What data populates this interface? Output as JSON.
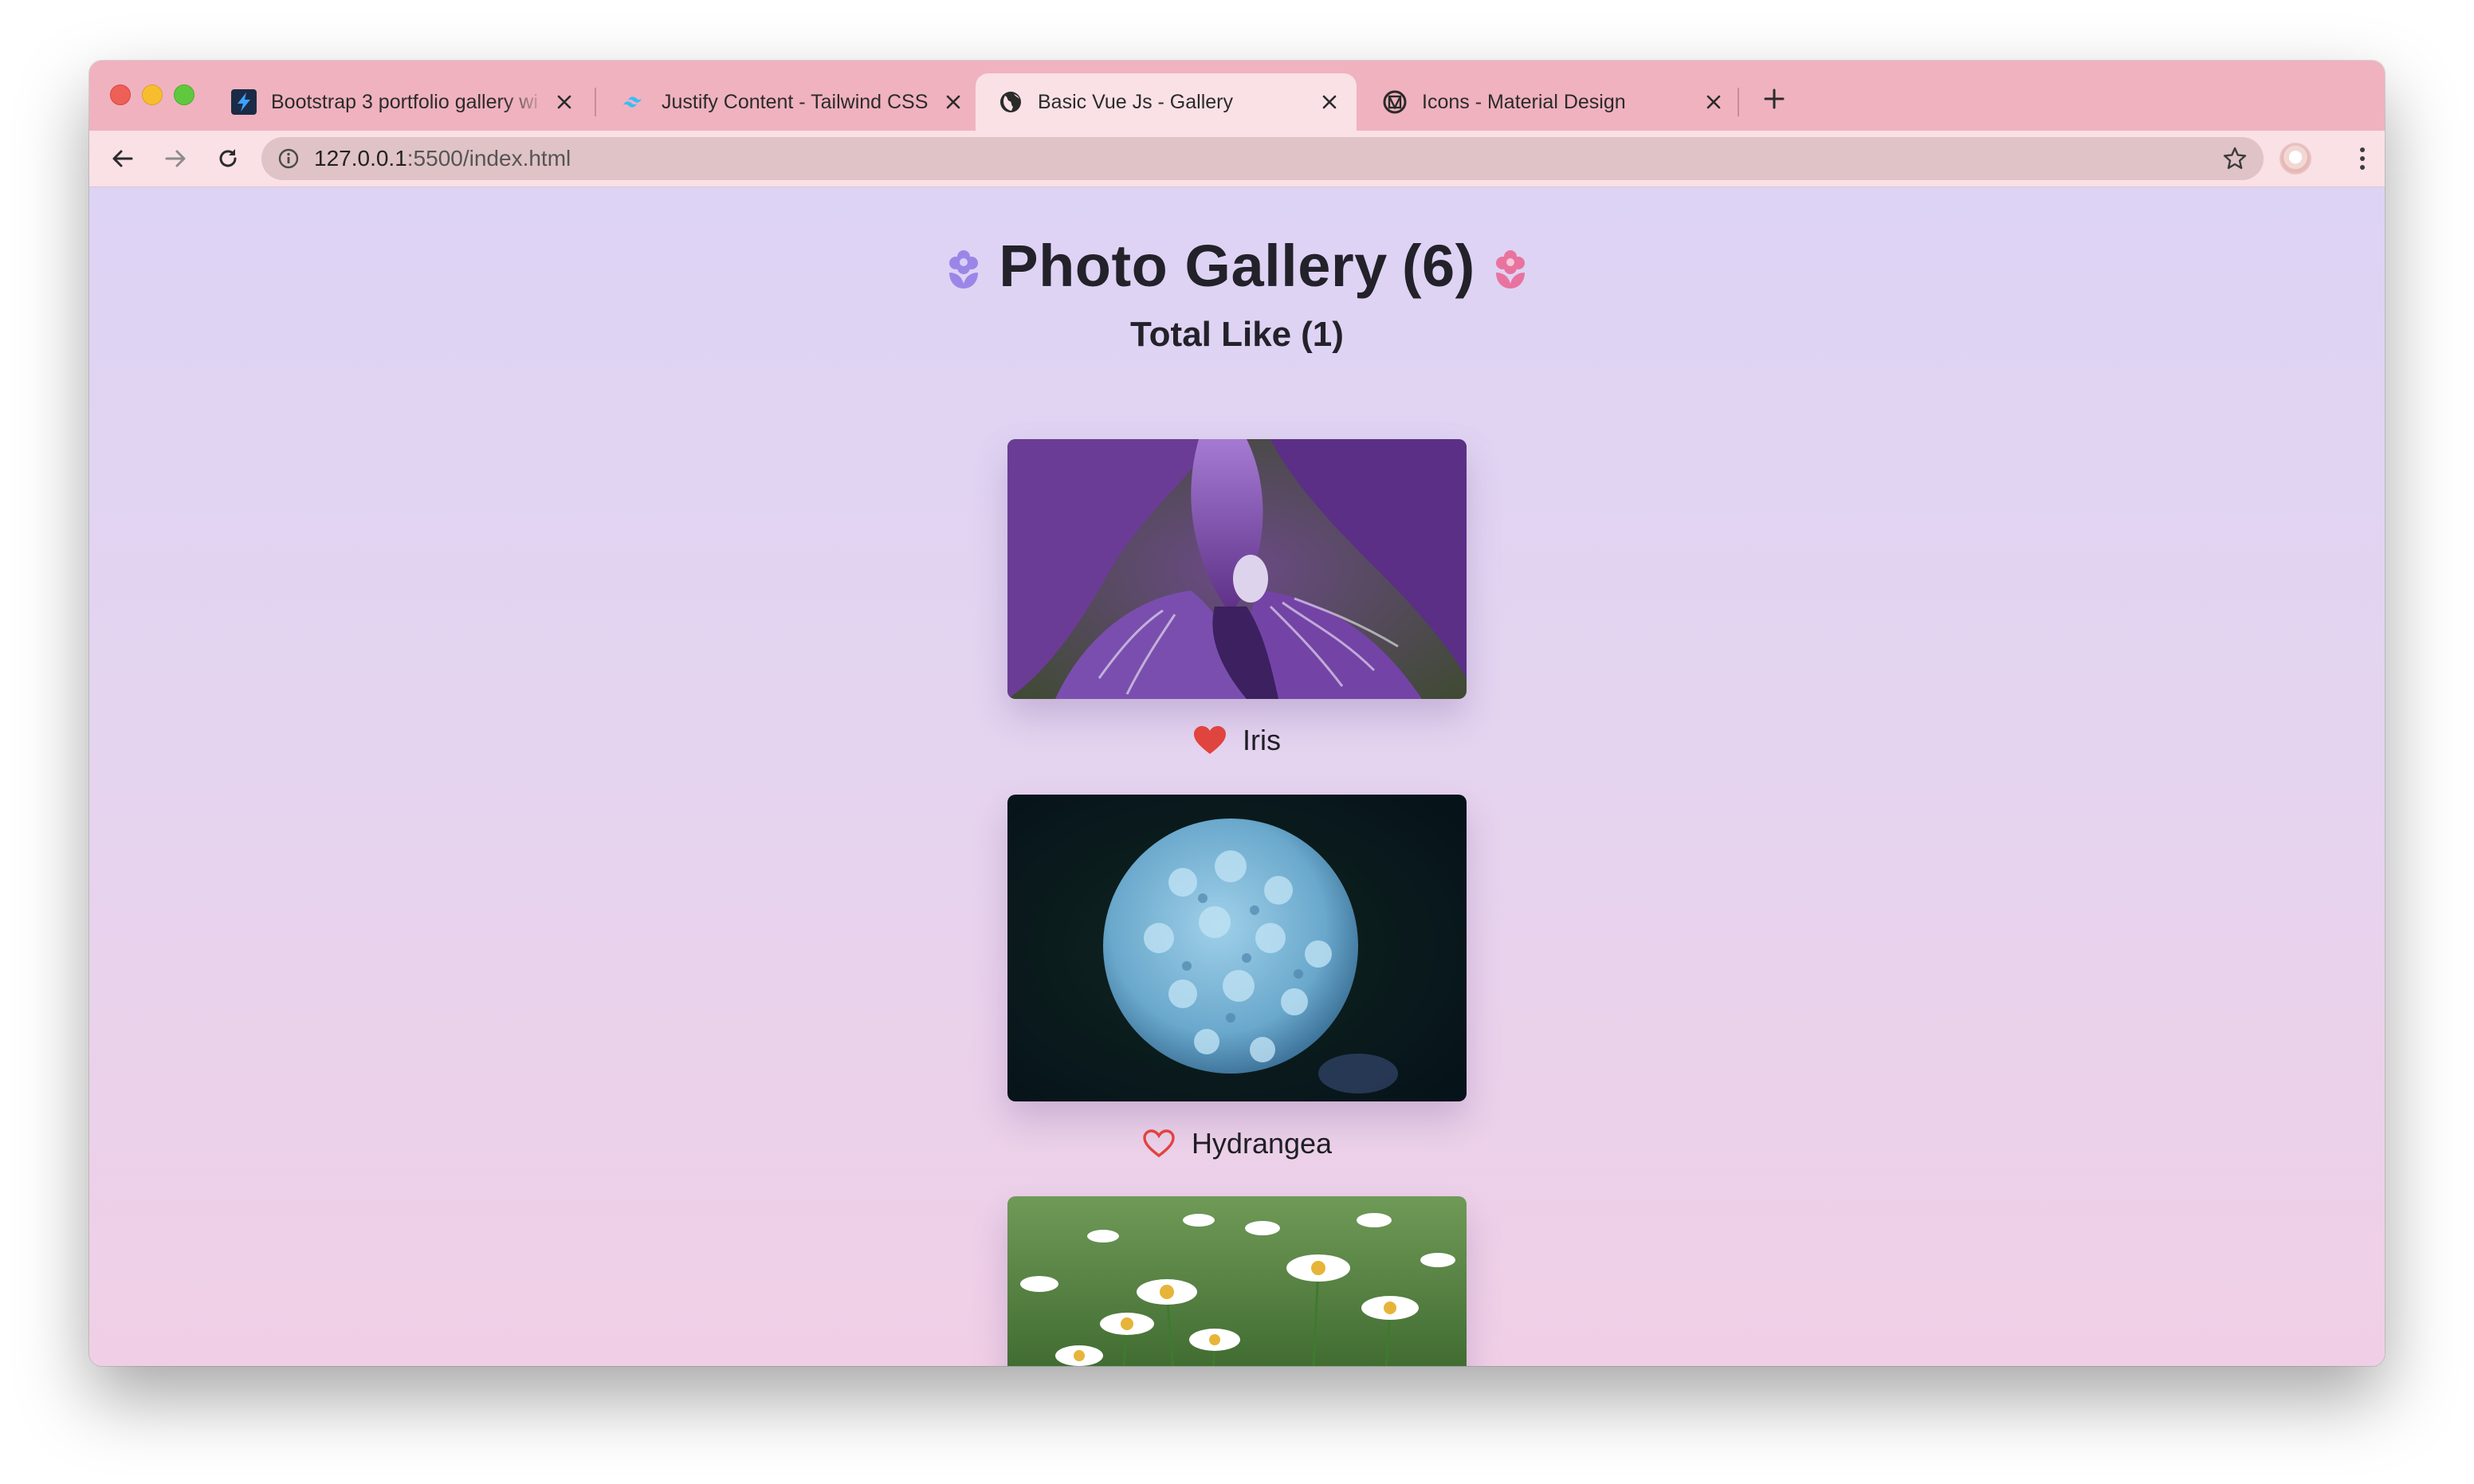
{
  "browser": {
    "tabs": [
      {
        "title": "Bootstrap 3 portfolio gallery wi",
        "icon": "bootstrap-lightning-icon",
        "active": false
      },
      {
        "title": "Justify Content - Tailwind CSS",
        "icon": "tailwind-logo-icon",
        "active": false
      },
      {
        "title": "Basic Vue Js - Gallery",
        "icon": "globe-icon",
        "active": true
      },
      {
        "title": "Icons - Material Design",
        "icon": "material-design-icon",
        "active": false
      }
    ],
    "address_bar": {
      "host": "127.0.0.1",
      "path": ":5500/index.html"
    }
  },
  "page": {
    "title": "Photo Gallery",
    "photo_count": "(6)",
    "total_like_label": "Total Like",
    "total_like_count": "(1)",
    "photos": [
      {
        "name": "Iris",
        "liked": true
      },
      {
        "name": "Hydrangea",
        "liked": false
      },
      {
        "name": "",
        "liked": false
      }
    ]
  },
  "colors": {
    "heart": "#e0443e",
    "title_icon_left": "#9b86e8",
    "title_icon_right": "#e8739f",
    "tab_strip": "#f0b2bf",
    "toolbar": "#f9e1e6"
  }
}
